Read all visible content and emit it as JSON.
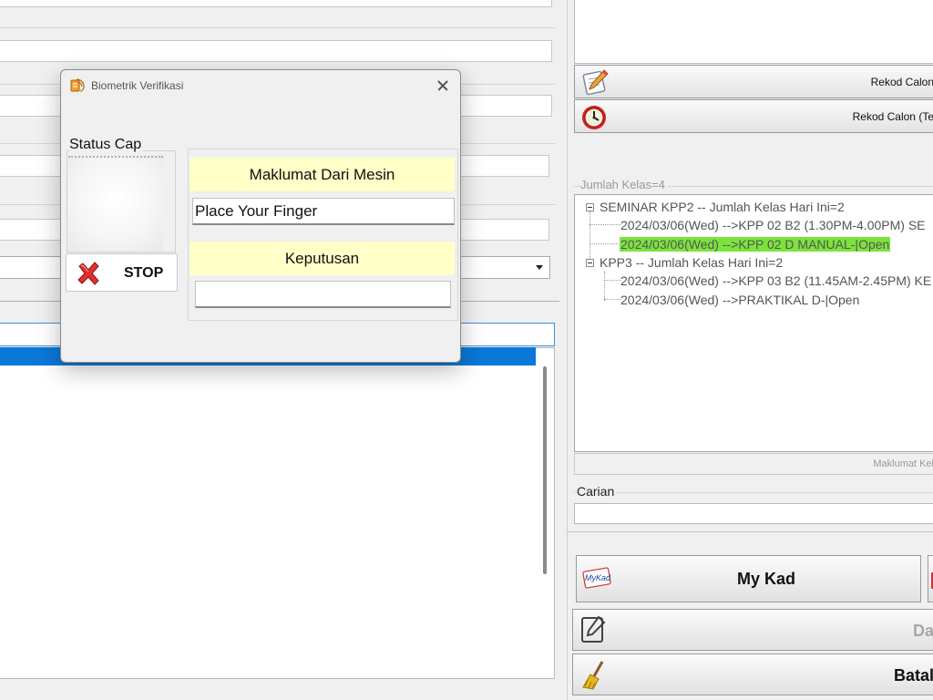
{
  "dialog": {
    "title": "Biometrik Verifikasi",
    "status_group_label": "Status Cap",
    "stop_label": "STOP",
    "maklumat_label": "Maklumat Dari Mesin",
    "machine_message": "Place Your Finger",
    "keputusan_label": "Keputusan",
    "keputusan_value": ""
  },
  "right": {
    "rekod_calon_label": "Rekod Calon",
    "rekod_calon_te_label": "Rekod Calon (Te",
    "jumlah_kelas": "Jumlah Kelas=4",
    "tree": {
      "group1": "SEMINAR KPP2 -- Jumlah Kelas Hari Ini=2",
      "group1_items": [
        "2024/03/06(Wed) -->KPP 02 B2 (1.30PM-4.00PM) SE",
        "2024/03/06(Wed) -->KPP 02 D MANUAL-|Open"
      ],
      "group2": "KPP3 -- Jumlah Kelas Hari Ini=2",
      "group2_items": [
        "2024/03/06(Wed) -->KPP 03 B2 (11.45AM-2.45PM) KE",
        "2024/03/06(Wed) -->PRAKTIKAL D-|Open"
      ],
      "highlight_color": "#7ce33d"
    },
    "maklumat_kelas": "Maklumat Kel",
    "carian_label": "Carian",
    "carian_value": "",
    "mykad_label": "My Kad",
    "mykad_icon_text": "MyKad",
    "da_label": "Da",
    "batal_label": "Batal"
  },
  "colors": {
    "selection_blue": "#0a78d7",
    "yellow_label": "#ffffc8"
  }
}
